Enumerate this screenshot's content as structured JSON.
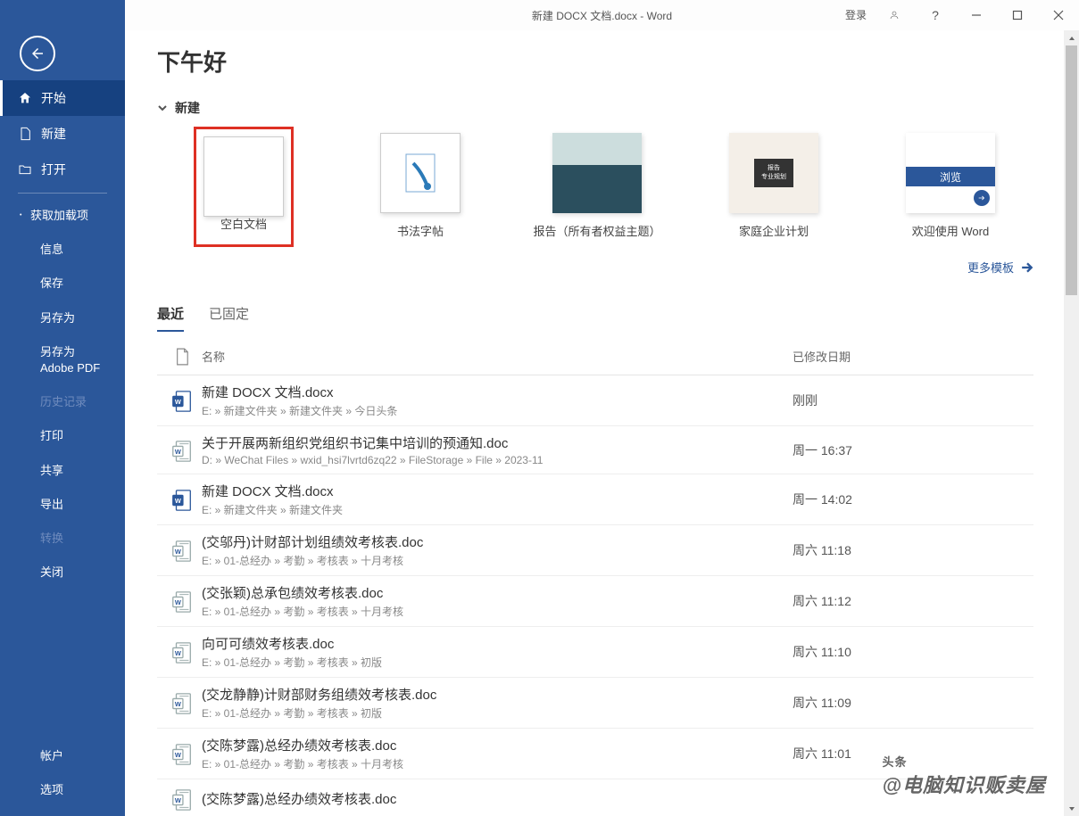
{
  "titlebar": {
    "title": "新建 DOCX 文档.docx  -  Word",
    "login": "登录"
  },
  "sidebar": {
    "start": "开始",
    "new": "新建",
    "open": "打开",
    "get_addins": "获取加载项",
    "info": "信息",
    "save": "保存",
    "save_as": "另存为",
    "save_as_pdf": "另存为 Adobe PDF",
    "history": "历史记录",
    "print": "打印",
    "share": "共享",
    "export": "导出",
    "convert": "转换",
    "close": "关闭",
    "account": "帐户",
    "options": "选项"
  },
  "greeting": "下午好",
  "new_section": "新建",
  "templates": [
    {
      "label": "空白文档"
    },
    {
      "label": "书法字帖"
    },
    {
      "label": "报告（所有者权益主题）"
    },
    {
      "label": "家庭企业计划"
    },
    {
      "label": "欢迎使用 Word"
    }
  ],
  "welcome_browse": "浏览",
  "family_badge_1": "报告",
  "family_badge_2": "专业规划",
  "more_templates": "更多模板",
  "tabs": {
    "recent": "最近",
    "pinned": "已固定"
  },
  "list_header": {
    "name": "名称",
    "date": "已修改日期"
  },
  "files": [
    {
      "name": "新建 DOCX 文档.docx",
      "path": "E: » 新建文件夹 » 新建文件夹 » 今日头条",
      "date": "刚刚",
      "type": "docx"
    },
    {
      "name": "关于开展两新组织党组织书记集中培训的预通知.doc",
      "path": "D: » WeChat Files » wxid_hsi7lvrtd6zq22 » FileStorage » File » 2023-11",
      "date": "周一 16:37",
      "type": "doc"
    },
    {
      "name": "新建 DOCX 文档.docx",
      "path": "E: » 新建文件夹 » 新建文件夹",
      "date": "周一 14:02",
      "type": "docx"
    },
    {
      "name": "(交邬丹)计财部计划组绩效考核表.doc",
      "path": "E: » 01-总经办 » 考勤 » 考核表 » 十月考核",
      "date": "周六 11:18",
      "type": "doc"
    },
    {
      "name": "(交张颖)总承包绩效考核表.doc",
      "path": "E: » 01-总经办 » 考勤 » 考核表 » 十月考核",
      "date": "周六 11:12",
      "type": "doc"
    },
    {
      "name": "向可可绩效考核表.doc",
      "path": "E: » 01-总经办 » 考勤 » 考核表 » 初版",
      "date": "周六 11:10",
      "type": "doc"
    },
    {
      "name": "(交龙静静)计财部财务组绩效考核表.doc",
      "path": "E: » 01-总经办 » 考勤 » 考核表 » 初版",
      "date": "周六 11:09",
      "type": "doc"
    },
    {
      "name": "(交陈梦露)总经办绩效考核表.doc",
      "path": "E: » 01-总经办 » 考勤 » 考核表 » 十月考核",
      "date": "周六 11:01",
      "type": "doc"
    },
    {
      "name": "(交陈梦露)总经办绩效考核表.doc",
      "path": "",
      "date": "",
      "type": "doc"
    }
  ],
  "watermark": {
    "tag": "头条",
    "author": "@电脑知识贩卖屋"
  }
}
